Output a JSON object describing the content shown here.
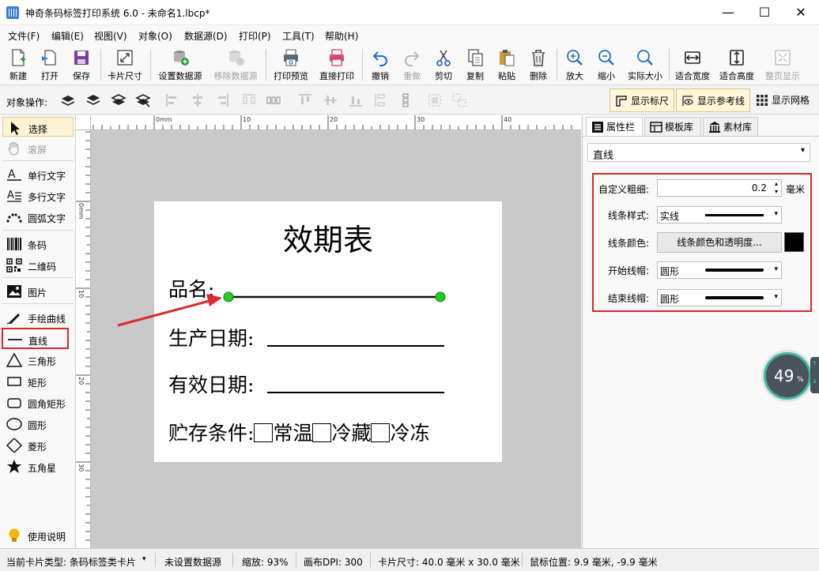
{
  "window": {
    "title": "神奇条码标签打印系统 6.0 - 未命名1.lbcp*",
    "min_glyph": "—",
    "max_glyph": "☐",
    "close_glyph": "✕"
  },
  "menu": [
    "文件(F)",
    "编辑(E)",
    "视图(V)",
    "对象(O)",
    "数据源(D)",
    "打印(P)",
    "工具(T)",
    "帮助(H)"
  ],
  "toolbar": {
    "new": "新建",
    "open": "打开",
    "save": "保存",
    "card_size": "卡片尺寸",
    "set_datasource": "设置数据源",
    "remove_datasource": "移除数据源",
    "print_preview": "打印预览",
    "direct_print": "直接打印",
    "undo": "撤销",
    "redo": "重做",
    "cut": "剪切",
    "copy": "复制",
    "paste": "粘贴",
    "delete": "删除",
    "zoom_in": "放大",
    "zoom_out": "缩小",
    "actual_size": "实际大小",
    "fit_width": "适合宽度",
    "fit_height": "适合高度",
    "full_page": "整页显示"
  },
  "ops": {
    "label": "对象操作:",
    "show_ruler": "显示标尺",
    "show_guides": "显示参考线",
    "show_grid": "显示网格"
  },
  "palette": {
    "select": "选择",
    "pan": "滚屏",
    "single_text": "单行文字",
    "multi_text": "多行文字",
    "arc_text": "圆弧文字",
    "barcode": "条码",
    "qrcode": "二维码",
    "image": "图片",
    "freehand": "手绘曲线",
    "line": "直线",
    "triangle": "三角形",
    "rect": "矩形",
    "round_rect": "圆角矩形",
    "ellipse": "圆形",
    "diamond": "菱形",
    "star": "五角星",
    "help": "使用说明"
  },
  "ruler": {
    "top": [
      "0mm",
      "10",
      "20",
      "30",
      "40"
    ],
    "left": [
      "0mm",
      "10",
      "20",
      "30"
    ]
  },
  "card": {
    "title": "效期表",
    "product_label": "品名:",
    "prod_date_label": "生产日期:",
    "expiry_label": "有效日期:",
    "storage_label": "贮存条件:",
    "opt_room": "常温",
    "opt_cold": "冷藏",
    "opt_frozen": "冷冻"
  },
  "panel": {
    "tab_props": "属性栏",
    "tab_templates": "模板库",
    "tab_assets": "素材库",
    "object_type": "直线",
    "thickness_label": "自定义粗细:",
    "thickness_value": "0.2",
    "thickness_unit": "毫米",
    "style_label": "线条样式:",
    "style_value": "实线",
    "color_label": "线条颜色:",
    "color_button": "线条颜色和透明度...",
    "line_color": "#000000",
    "start_cap_label": "开始线帽:",
    "start_cap_value": "圆形",
    "end_cap_label": "结束线帽:",
    "end_cap_value": "圆形"
  },
  "gauge": {
    "value": "49",
    "unit": "%"
  },
  "status": {
    "card_type": "当前卡片类型: 条码标签类卡片",
    "datasource": "未设置数据源",
    "zoom": "缩放: 93%",
    "dpi": "画布DPI: 300",
    "card_size": "卡片尺寸: 40.0 毫米 x 30.0 毫米",
    "mouse_pos": "鼠标位置: 9.9 毫米, -9.9 毫米"
  },
  "colors": {
    "highlight_red": "#d8262b",
    "handle_green": "#22cc22",
    "selected_tool_bg": "#fbf3d3"
  }
}
